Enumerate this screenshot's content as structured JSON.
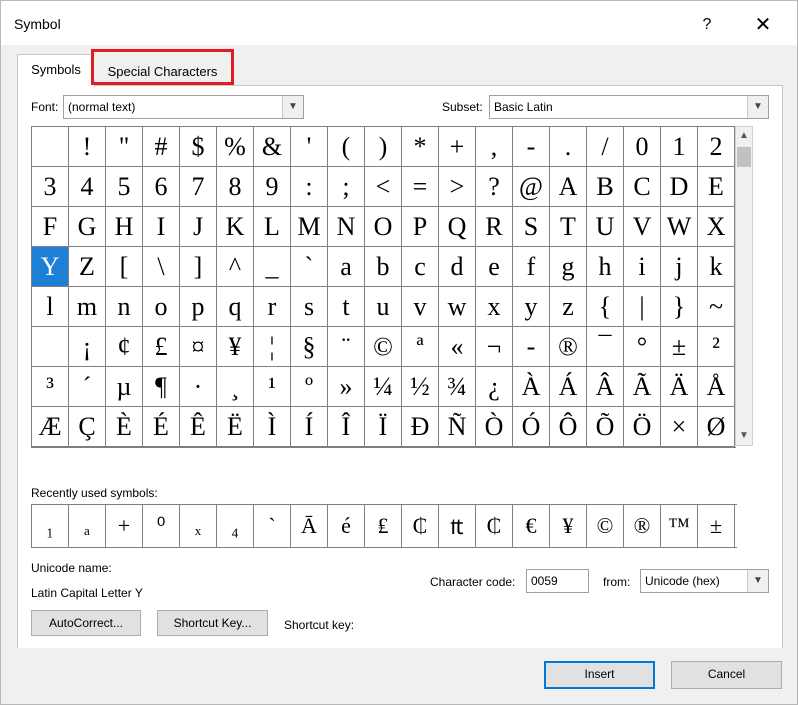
{
  "window": {
    "title": "Symbol",
    "help": "?",
    "close": "✕"
  },
  "tabs": {
    "symbols": "Symbols",
    "special": "Special Characters"
  },
  "font": {
    "label": "Font:",
    "value": "(normal text)"
  },
  "subset": {
    "label": "Subset:",
    "value": "Basic Latin"
  },
  "symbols": [
    " ",
    "!",
    "\"",
    "#",
    "$",
    "%",
    "&",
    "'",
    "(",
    ")",
    "*",
    "+",
    ",",
    "-",
    ".",
    "/",
    "0",
    "1",
    "2",
    "3",
    "4",
    "5",
    "6",
    "7",
    "8",
    "9",
    ":",
    ";",
    "<",
    "=",
    ">",
    "?",
    "@",
    "A",
    "B",
    "C",
    "D",
    "E",
    "F",
    "G",
    "H",
    "I",
    "J",
    "K",
    "L",
    "M",
    "N",
    "O",
    "P",
    "Q",
    "R",
    "S",
    "T",
    "U",
    "V",
    "W",
    "X",
    "Y",
    "Z",
    "[",
    "\\",
    "]",
    "^",
    "_",
    "`",
    "a",
    "b",
    "c",
    "d",
    "e",
    "f",
    "g",
    "h",
    "i",
    "j",
    "k",
    "l",
    "m",
    "n",
    "o",
    "p",
    "q",
    "r",
    "s",
    "t",
    "u",
    "v",
    "w",
    "x",
    "y",
    "z",
    "{",
    "|",
    "}",
    "~",
    " ",
    "¡",
    "¢",
    "£",
    "¤",
    "¥",
    "¦",
    "§",
    "¨",
    "©",
    "ª",
    "«",
    "¬",
    "-",
    "®",
    "¯",
    "°",
    "±",
    "²",
    "³",
    "´",
    "µ",
    "¶",
    "·",
    "¸",
    "¹",
    "º",
    "»",
    "¼",
    "½",
    "¾",
    "¿",
    "À",
    "Á",
    "Â",
    "Ã",
    "Ä",
    "Å",
    "Æ",
    "Ç",
    "È",
    "É",
    "Ê",
    "Ë",
    "Ì",
    "Í",
    "Î",
    "Ï",
    "Ð",
    "Ñ",
    "Ò",
    "Ó",
    "Ô",
    "Õ",
    "Ö",
    "×",
    "Ø"
  ],
  "selected_index": 57,
  "recent": {
    "label": "Recently used symbols:",
    "items": [
      "₁",
      "ₐ",
      "+",
      "⁰",
      "ₓ",
      "₄",
      "`",
      "Ā",
      "é",
      "₤",
      "₵",
      "₶",
      "₵",
      "€",
      "¥",
      "©",
      "®",
      "™",
      "±"
    ]
  },
  "unicode_name": {
    "label": "Unicode name:",
    "value": "Latin Capital Letter Y"
  },
  "char_code": {
    "label": "Character code:",
    "value": "0059"
  },
  "from": {
    "label": "from:",
    "value": "Unicode (hex)"
  },
  "buttons": {
    "autocorrect": "AutoCorrect...",
    "shortcut_key": "Shortcut Key...",
    "insert": "Insert",
    "cancel": "Cancel"
  },
  "shortcut_label": "Shortcut key:"
}
